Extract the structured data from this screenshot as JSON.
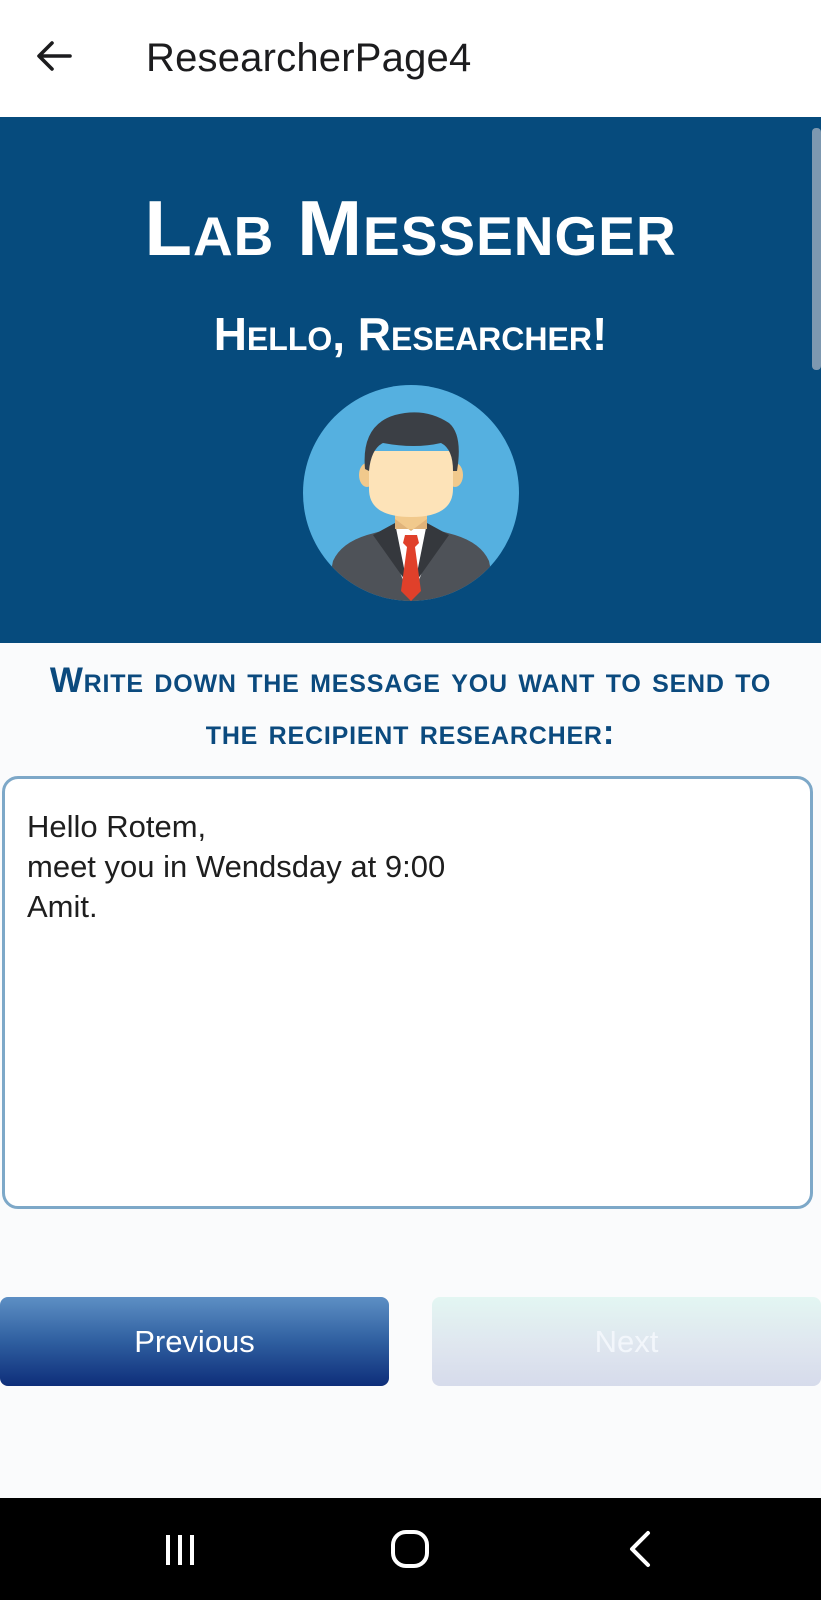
{
  "appbar": {
    "title": "ResearcherPage4",
    "back_icon": "arrow-left-icon"
  },
  "header": {
    "app_title": "Lab Messenger",
    "greeting": "Hello, Researcher!",
    "avatar_icon": "researcher-avatar-icon",
    "background_color": "#064b7d"
  },
  "prompt": {
    "text": "Write down the message you want to send to the recipient researcher:",
    "color": "#0b4a7e"
  },
  "message": {
    "value": "Hello Rotem,\nmeet you in Wendsday at 9:00\nAmit."
  },
  "buttons": {
    "previous_label": "Previous",
    "next_label": "Next"
  },
  "navbar": {
    "recents_icon": "recents-icon",
    "home_icon": "home-icon",
    "back_icon": "back-chevron-icon"
  }
}
